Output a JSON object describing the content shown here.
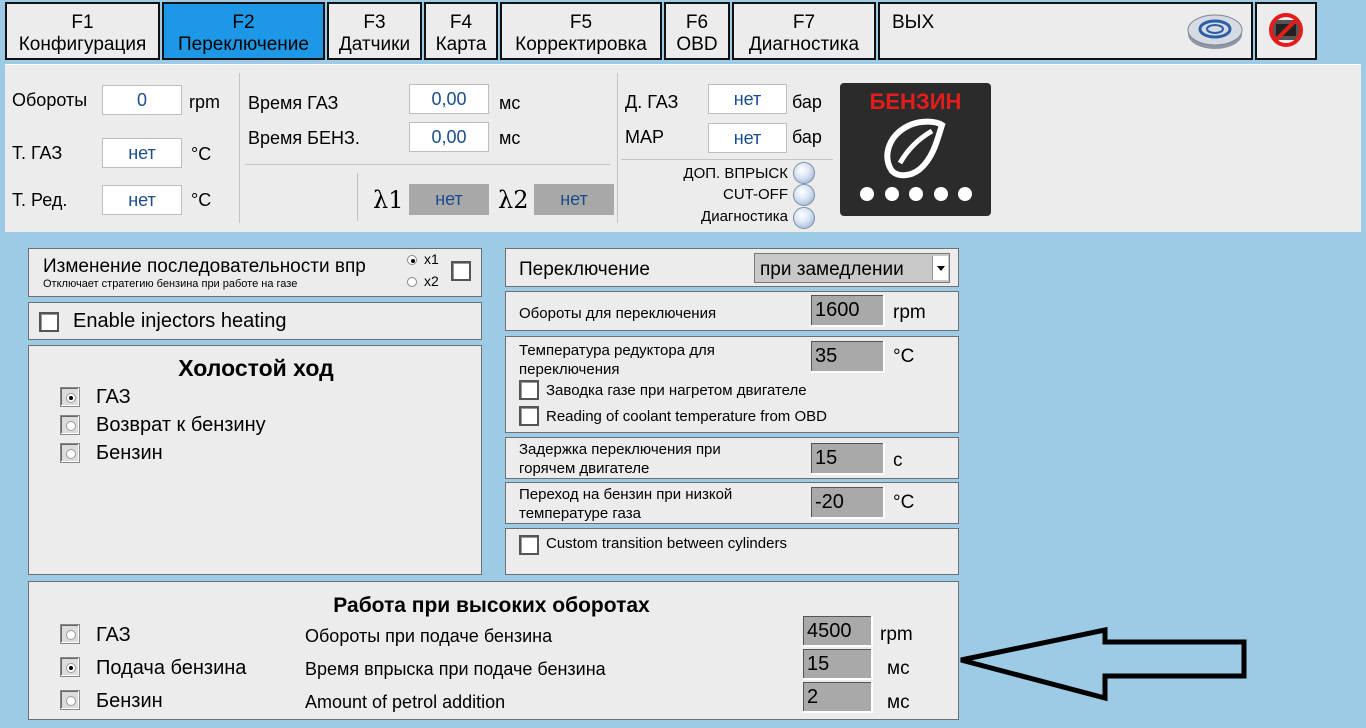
{
  "tabs": [
    {
      "key": "F1",
      "label": "Конфигурация"
    },
    {
      "key": "F2",
      "label": "Переключение"
    },
    {
      "key": "F3",
      "label": "Датчики"
    },
    {
      "key": "F4",
      "label": "Карта"
    },
    {
      "key": "F5",
      "label": "Корректировка"
    },
    {
      "key": "F6",
      "label": "OBD"
    },
    {
      "key": "F7",
      "label": "Диагностика"
    }
  ],
  "exit_label": "ВЫХ",
  "status": {
    "rpm_label": "Обороты",
    "rpm_value": "0",
    "rpm_unit": "rpm",
    "tgas_label": "Т. ГАЗ",
    "tgas_value": "нет",
    "tgas_unit": "°C",
    "tred_label": "Т. Ред.",
    "tred_value": "нет",
    "tred_unit": "°C",
    "time_gas_label": "Время ГАЗ",
    "time_gas_value": "0,00",
    "time_gas_unit": "мс",
    "time_benz_label": "Время БЕНЗ.",
    "time_benz_value": "0,00",
    "time_benz_unit": "мс",
    "lambda1_label": "λ1",
    "lambda1_value": "нет",
    "lambda2_label": "λ2",
    "lambda2_value": "нет",
    "dgas_label": "Д. ГАЗ",
    "dgas_value": "нет",
    "dgas_unit": "бар",
    "map_label": "MAP",
    "map_value": "нет",
    "map_unit": "бар",
    "dop_label": "ДОП. ВПРЫСК",
    "cutoff_label": "CUT-OFF",
    "diag_label": "Диагностика",
    "fuel_badge": "БЕНЗИН"
  },
  "sequence": {
    "title": "Изменение последовательности впр",
    "subtitle": "Отключает стратегию бензина при работе на газе",
    "x1": "x1",
    "x2": "x2"
  },
  "injectors_heating": "Enable injectors heating",
  "idle": {
    "title": "Холостой ход",
    "options": [
      "ГАЗ",
      "Возврат к бензину",
      "Бензин"
    ],
    "selected": 0
  },
  "switch": {
    "label": "Переключение",
    "mode": "при замедлении",
    "rpm_label": "Обороты для переключения",
    "rpm_value": "1600",
    "rpm_unit": "rpm",
    "temp_label": "Температура редуктора для переключения",
    "temp_value": "35",
    "temp_unit": "°C",
    "warm_start": "Заводка газе при нагретом двигателе",
    "coolant_obd": "Reading of coolant temperature from OBD",
    "delay_label": "Задержка переключения при горячем двигателе",
    "delay_value": "15",
    "delay_unit": "с",
    "lowtemp_label": "Переход на бензин при низкой температуре газа",
    "lowtemp_value": "-20",
    "lowtemp_unit": "°C",
    "custom_transition": "Custom transition between cylinders"
  },
  "high_rpm": {
    "title": "Работа при высоких оборотах",
    "options": [
      "ГАЗ",
      "Подача бензина",
      "Бензин"
    ],
    "selected": 1,
    "rows": [
      {
        "label": "Обороты при подаче бензина",
        "value": "4500",
        "unit": "rpm"
      },
      {
        "label": "Время впрыска при подаче бензина",
        "value": "15",
        "unit": "мс"
      },
      {
        "label": "Amount of petrol addition",
        "value": "2",
        "unit": "мс"
      }
    ]
  },
  "colors": {
    "background": "#9dcbe6",
    "active_tab": "#1c98e6",
    "badge_red": "#e41c1c"
  }
}
